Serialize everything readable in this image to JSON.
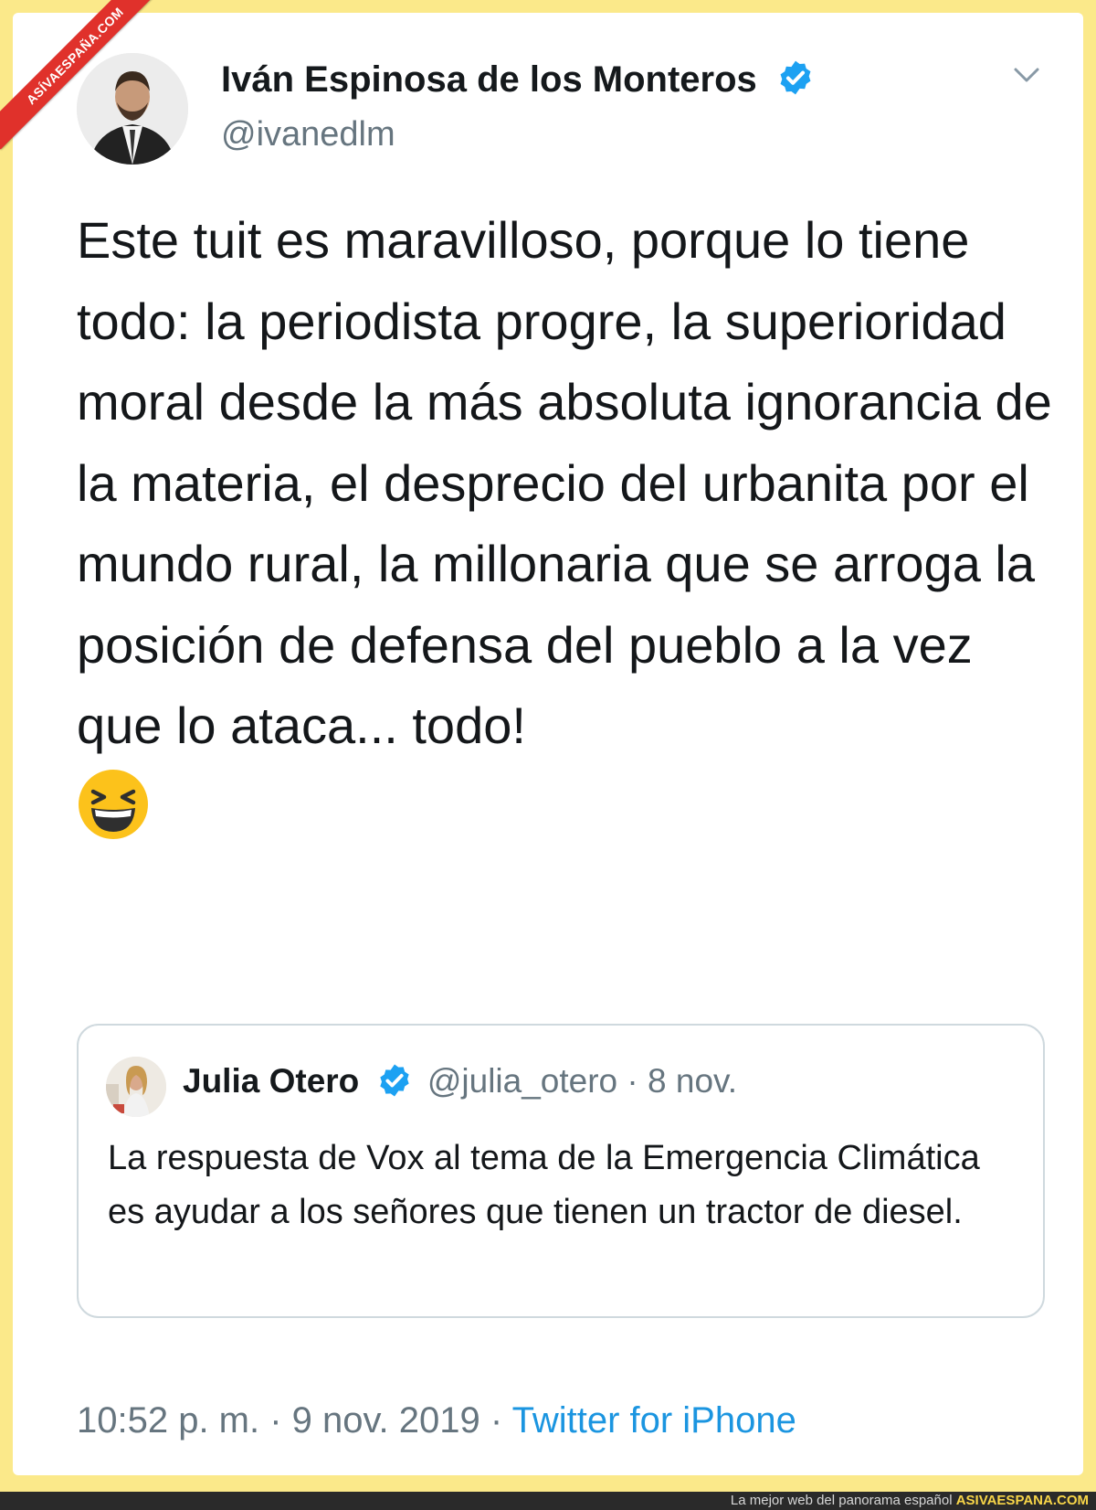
{
  "watermark": {
    "ribbon": "ASÍVAESPAÑA.COM"
  },
  "tweet": {
    "author_name": "Iván Espinosa de los Monteros",
    "handle": "@ivanedlm",
    "text": "Este tuit es maravilloso, porque lo tiene todo: la periodista progre, la superioridad moral desde la más absoluta ignorancia de la materia, el desprecio del urbanita por el mundo rural, la millonaria que se arroga la posición de defensa del pueblo a la vez que lo ataca... todo!",
    "emoji": "grinning-squinting-face-icon",
    "timestamp": "10:52 p. m. · 9 nov. 2019 · ",
    "source": "Twitter for iPhone"
  },
  "quoted": {
    "author_name": "Julia Otero",
    "meta": "@julia_otero · 8 nov.",
    "text": "La respuesta de Vox al tema de la Emergencia Climática es ayudar a los señores que tienen un tractor de diesel."
  },
  "footer": {
    "tagline": "La mejor web del panorama español ",
    "brand": "ASIVAESPANA.COM"
  },
  "colors": {
    "background": "#fbe98a",
    "verified": "#1da1f2",
    "link": "#1b95e0",
    "ribbon": "#e0312b"
  }
}
